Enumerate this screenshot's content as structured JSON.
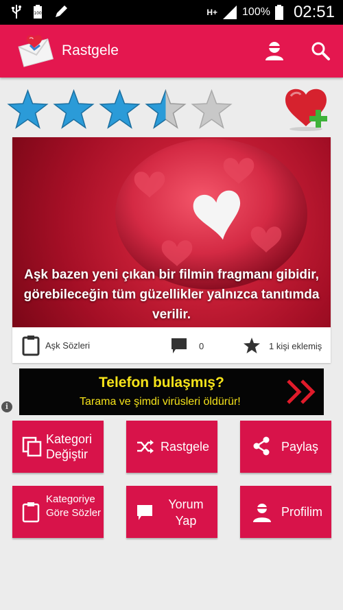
{
  "status_bar": {
    "battery_percent": "100%",
    "time": "02:51",
    "network": "H+",
    "icons": [
      "usb-icon",
      "battery-100-icon",
      "pen-icon",
      "signal-icon",
      "battery-icon"
    ]
  },
  "app_bar": {
    "title": "Rastgele",
    "icons": [
      "profile-icon",
      "search-icon"
    ]
  },
  "rating": {
    "stars_total": 5,
    "value": 3.5,
    "filled_color": "#2b9bd8",
    "empty_color": "#c8c8c8"
  },
  "card": {
    "quote": "Aşk bazen yeni çıkan bir filmin fragmanı gibidir, görebileceğin tüm güzellikler yalnızca tanıtımda verilir.",
    "category": "Aşk Sözleri",
    "comment_count": "0",
    "favorites": "1 kişi eklemiş"
  },
  "ad": {
    "title": "Telefon bulaşmış?",
    "subtitle": "Tarama ve şimdi virüsleri öldürür!",
    "info": "i"
  },
  "menu": {
    "change_category": "Kategori Değiştir",
    "random": "Rastgele",
    "share": "Paylaş",
    "by_category": "Kategoriye Göre Sözler",
    "comment": "Yorum Yap",
    "profile": "Profilim"
  },
  "colors": {
    "accent": "#e4174f",
    "button": "#d8134a",
    "ad_text": "#f6e31a"
  }
}
